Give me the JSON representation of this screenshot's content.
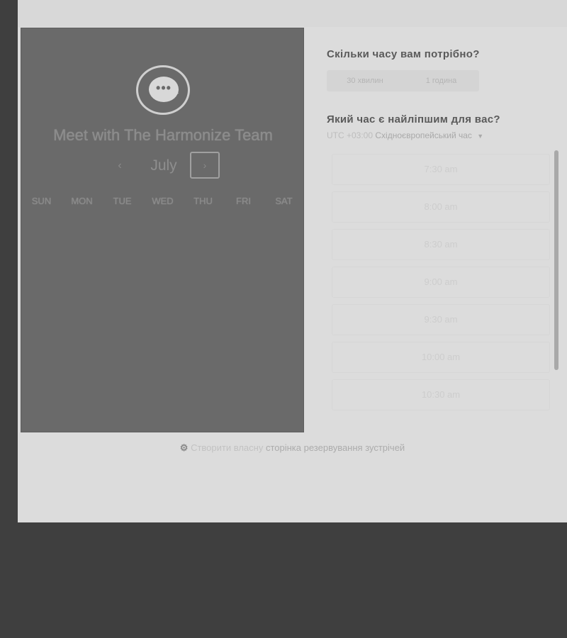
{
  "booking": {
    "title": "Meet with The Harmonize Team",
    "month": "July",
    "prev_icon": "‹",
    "next_icon": "›",
    "weekdays": [
      "SUN",
      "MON",
      "TUE",
      "WED",
      "THU",
      "FRI",
      "SAT"
    ]
  },
  "duration": {
    "question": "Скільки часу вам потрібно?",
    "options": [
      "30 хвилин",
      "1 година"
    ]
  },
  "time": {
    "question": "Який час є найліпшим для вас?",
    "timezone_offset": "UTC +03:00",
    "timezone_name": "Східноєвропейський час",
    "slots": [
      "7:30 am",
      "8:00 am",
      "8:30 am",
      "9:00 am",
      "9:30 am",
      "10:00 am",
      "10:30 am"
    ]
  },
  "footer": {
    "prefix": "Створити власну",
    "link": "сторінка резервування зустрічей"
  }
}
